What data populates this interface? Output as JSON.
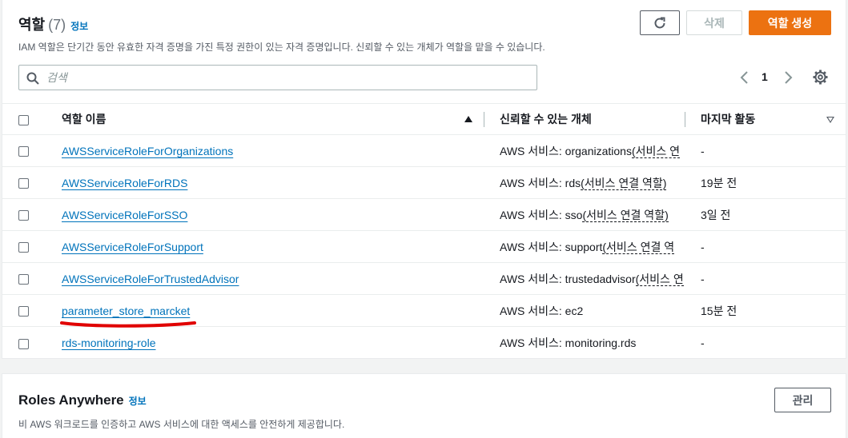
{
  "roles_panel": {
    "title": "역할",
    "count": "(7)",
    "info_label": "정보",
    "description": "IAM 역할은 단기간 동안 유효한 자격 증명을 가진 특정 권한이 있는 자격 증명입니다. 신뢰할 수 있는 개체가 역할을 맡을 수 있습니다.",
    "refresh_icon": "refresh-icon",
    "delete_label": "삭제",
    "create_label": "역할 생성",
    "search_placeholder": "검색",
    "search_value": "",
    "page": "1",
    "columns": {
      "name": "역할 이름",
      "trusted": "신뢰할 수 있는 개체",
      "last_activity": "마지막 활동"
    },
    "rows": [
      {
        "name": "AWSServiceRoleForOrganizations",
        "trust_prefix": "AWS 서비스: organizations",
        "trust_suffix": "(서비스 연",
        "last": "-"
      },
      {
        "name": "AWSServiceRoleForRDS",
        "trust_prefix": "AWS 서비스: rds",
        "trust_suffix": "(서비스 연결 역할)",
        "last": "19분 전"
      },
      {
        "name": "AWSServiceRoleForSSO",
        "trust_prefix": "AWS 서비스: sso",
        "trust_suffix": "(서비스 연결 역할)",
        "last": "3일 전"
      },
      {
        "name": "AWSServiceRoleForSupport",
        "trust_prefix": "AWS 서비스: support",
        "trust_suffix": "(서비스 연결 역",
        "last": "-"
      },
      {
        "name": "AWSServiceRoleForTrustedAdvisor",
        "trust_prefix": "AWS 서비스: trustedadvisor",
        "trust_suffix": "(서비스 연",
        "last": "-"
      },
      {
        "name": "parameter_store_marcket",
        "trust_prefix": "AWS 서비스: ec2",
        "trust_suffix": "",
        "last": "15분 전"
      },
      {
        "name": "rds-monitoring-role",
        "trust_prefix": "AWS 서비스: monitoring.rds",
        "trust_suffix": "",
        "last": "-"
      }
    ],
    "highlight_color": "#e00000"
  },
  "anywhere_panel": {
    "title": "Roles Anywhere",
    "info_label": "정보",
    "description": "비 AWS 워크로드를 인증하고 AWS 서비스에 대한 액세스를 안전하게 제공합니다.",
    "manage_label": "관리"
  },
  "colors": {
    "accent": "#ec7211",
    "link": "#0073bb"
  }
}
